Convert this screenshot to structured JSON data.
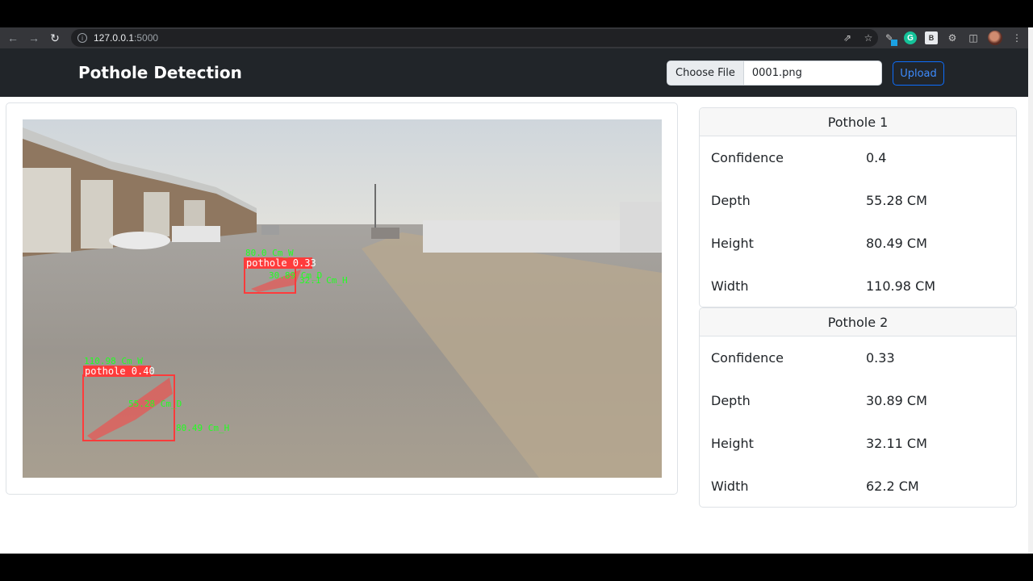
{
  "browser": {
    "url_host": "127.0.0.1",
    "url_port": ":5000",
    "icons": [
      "back-icon",
      "forward-icon",
      "reload-icon",
      "share-icon",
      "star-icon",
      "pen-extension-icon",
      "grammarly-icon",
      "b-extension-icon",
      "puzzle-icon",
      "sidebar-icon",
      "avatar",
      "kebab-menu-icon"
    ]
  },
  "navbar": {
    "brand": "Pothole Detection",
    "file_button": "Choose File",
    "file_name": "0001.png",
    "upload_label": "Upload"
  },
  "image": {
    "detections": [
      {
        "label": "pothole 0.33",
        "width_text": "80.0 Cm_W",
        "depth_text": "30.89 Cm_D",
        "height_text": "32.1 Cm_H"
      },
      {
        "label": "pothole 0.40",
        "width_text": "110.98 Cm_W",
        "depth_text": "55.28 Cm_D",
        "height_text": "80.49 Cm_H"
      }
    ],
    "colors": {
      "box": "#ff3b3b",
      "measure": "#22ff22"
    }
  },
  "potholes": [
    {
      "title": "Pothole 1",
      "rows": [
        {
          "label": "Confidence",
          "value": "0.4"
        },
        {
          "label": "Depth",
          "value": "55.28 CM"
        },
        {
          "label": "Height",
          "value": "80.49 CM"
        },
        {
          "label": "Width",
          "value": "110.98 CM"
        }
      ]
    },
    {
      "title": "Pothole 2",
      "rows": [
        {
          "label": "Confidence",
          "value": "0.33"
        },
        {
          "label": "Depth",
          "value": "30.89 CM"
        },
        {
          "label": "Height",
          "value": "32.11 CM"
        },
        {
          "label": "Width",
          "value": "62.2 CM"
        }
      ]
    }
  ]
}
